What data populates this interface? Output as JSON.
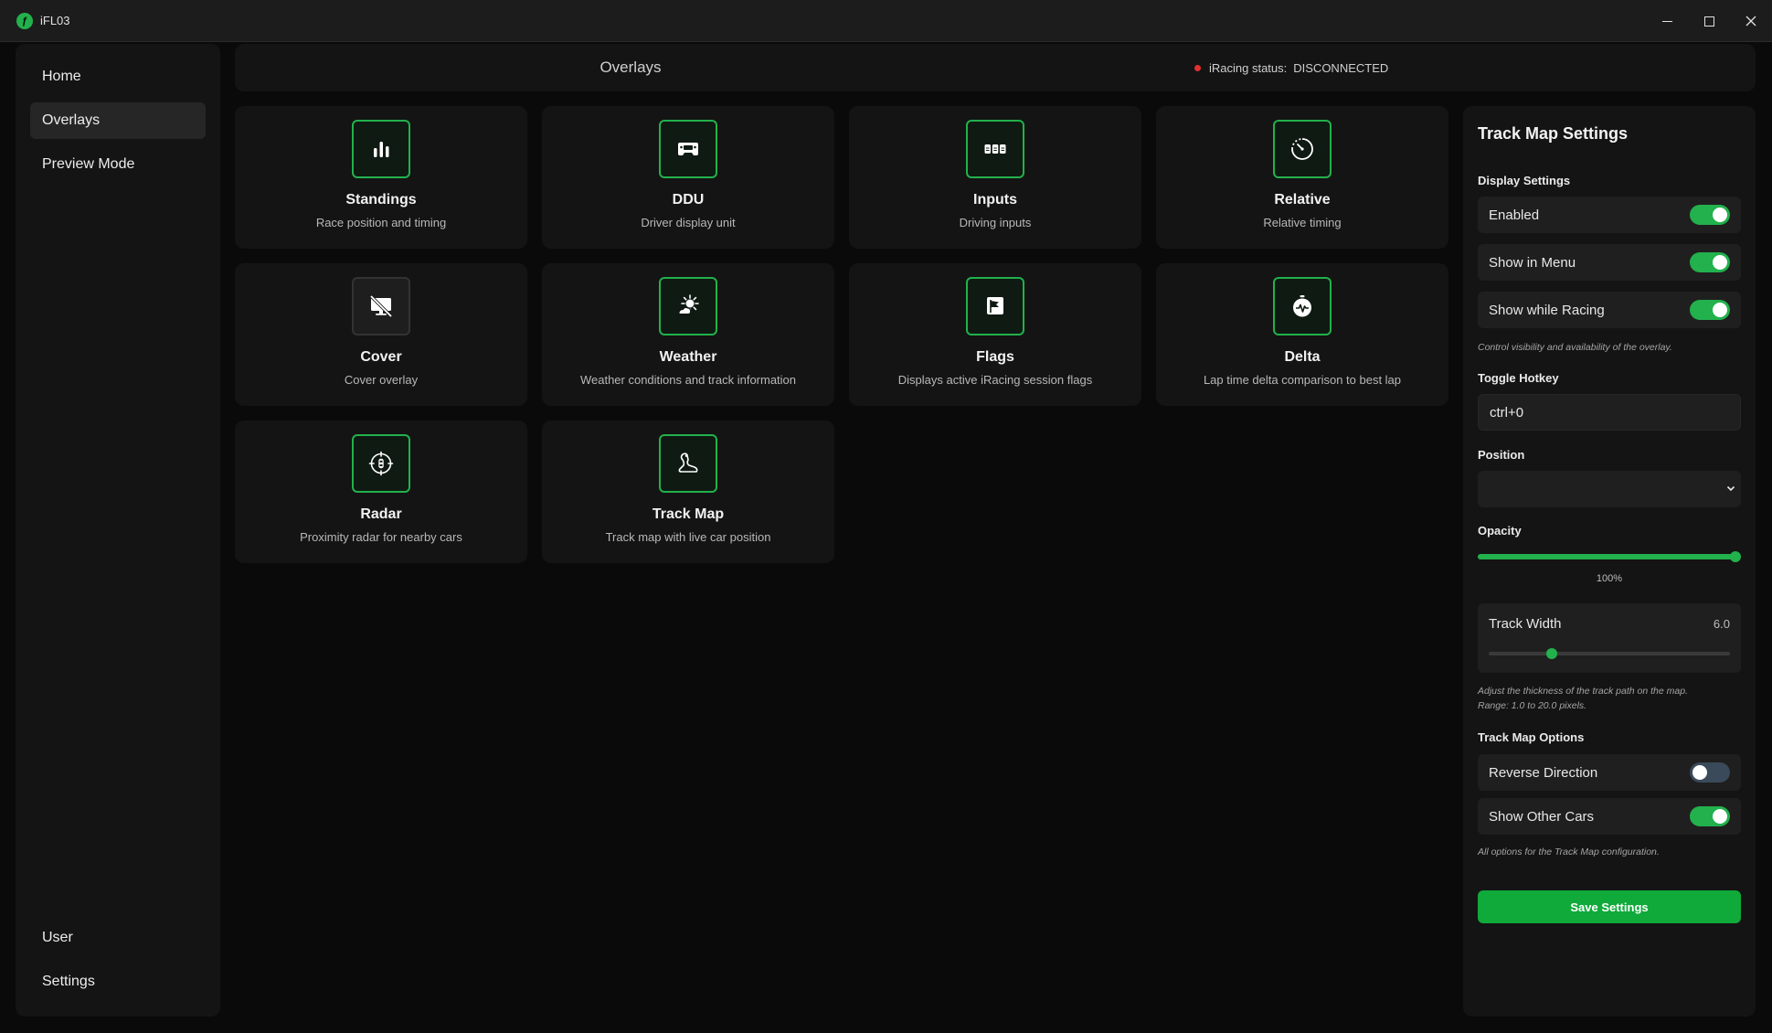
{
  "window": {
    "title": "iFL03"
  },
  "sidebar": {
    "items": [
      {
        "label": "Home"
      },
      {
        "label": "Overlays"
      },
      {
        "label": "Preview Mode"
      }
    ],
    "bottom_items": [
      {
        "label": "User"
      },
      {
        "label": "Settings"
      }
    ]
  },
  "header": {
    "title": "Overlays",
    "status_label": "iRacing status:",
    "status_value": "DISCONNECTED"
  },
  "overlays": [
    {
      "title": "Standings",
      "description": "Race position and timing",
      "icon": "bar-chart-icon"
    },
    {
      "title": "DDU",
      "description": "Driver display unit",
      "icon": "steering-wheel-icon"
    },
    {
      "title": "Inputs",
      "description": "Driving inputs",
      "icon": "pedals-icon"
    },
    {
      "title": "Relative",
      "description": "Relative timing",
      "icon": "timer-icon"
    },
    {
      "title": "Cover",
      "description": "Cover overlay",
      "icon": "monitor-off-icon"
    },
    {
      "title": "Weather",
      "description": "Weather conditions and track information",
      "icon": "sun-cloud-icon"
    },
    {
      "title": "Flags",
      "description": "Displays active iRacing session flags",
      "icon": "flag-icon"
    },
    {
      "title": "Delta",
      "description": "Lap time delta comparison to best lap",
      "icon": "stopwatch-icon"
    },
    {
      "title": "Radar",
      "description": "Proximity radar for nearby cars",
      "icon": "radar-icon"
    },
    {
      "title": "Track Map",
      "description": "Track map with live car position",
      "icon": "track-icon"
    }
  ],
  "settings": {
    "title": "Track Map Settings",
    "display_settings_label": "Display Settings",
    "toggles": [
      {
        "label": "Enabled",
        "on": true
      },
      {
        "label": "Show in Menu",
        "on": true
      },
      {
        "label": "Show while Racing",
        "on": true
      }
    ],
    "display_note": "Control visibility and availability of the overlay.",
    "hotkey_label": "Toggle Hotkey",
    "hotkey_value": "ctrl+0",
    "position_label": "Position",
    "position_value": "",
    "opacity_label": "Opacity",
    "opacity_value": "100%",
    "opacity_fraction": 1.0,
    "track_width_label": "Track Width",
    "track_width_value": "6.0",
    "track_width_min": 1.0,
    "track_width_max": 20.0,
    "track_width_note_1": "Adjust the thickness of the track path on the map.",
    "track_width_note_2": "Range: 1.0 to 20.0 pixels.",
    "options_label": "Track Map Options",
    "options": [
      {
        "label": "Reverse Direction",
        "on": false
      },
      {
        "label": "Show Other Cars",
        "on": true
      }
    ],
    "options_note": "All options for the Track Map configuration.",
    "save_label": "Save Settings"
  },
  "colors": {
    "accent": "#22b14c",
    "status_error": "#e03131",
    "background": "#0a0a0a",
    "panel": "#141414"
  }
}
